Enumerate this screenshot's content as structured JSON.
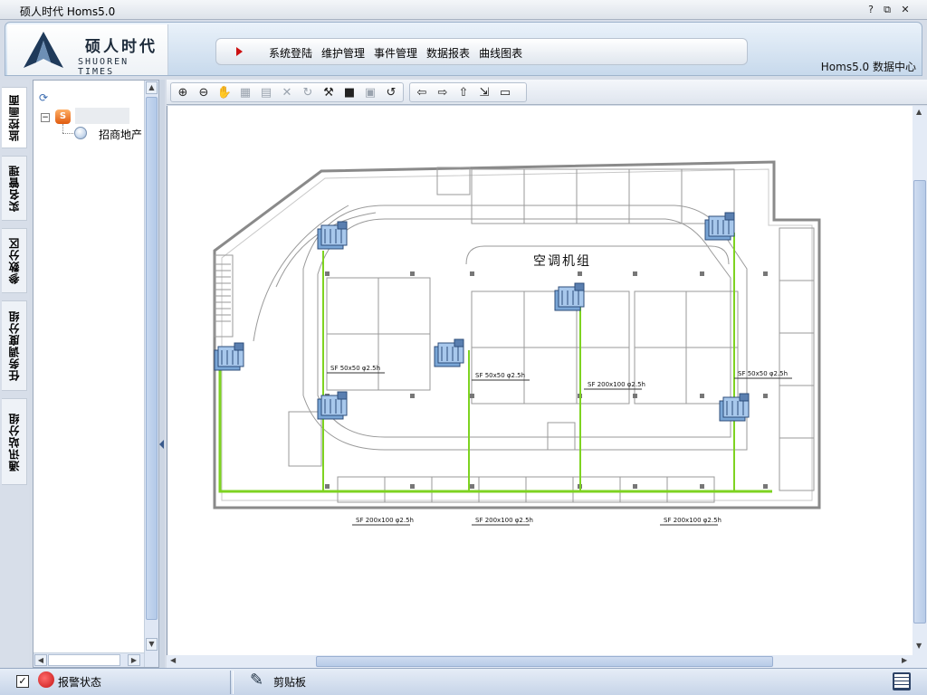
{
  "window": {
    "title": "硕人时代  Homs5.0",
    "help_label": "?",
    "restore_label": "⧉",
    "close_label": "✕"
  },
  "header": {
    "logo_cn": "硕人时代",
    "logo_en": "SHUOREN TIMES",
    "nav": [
      "系统登陆",
      "维护管理",
      "事件管理",
      "数据报表",
      "曲线图表"
    ],
    "right_label": "Homs5.0 数据中心"
  },
  "vtabs": [
    "监控画面",
    "实名管理",
    "参数分区",
    "任务调度分组",
    "通讯站分组"
  ],
  "tree": {
    "refresh_icon": "refresh-icon",
    "expander": "−",
    "root_icon_glyph": "S",
    "child_label": "招商地产"
  },
  "toolbar": {
    "group1": [
      {
        "icon": "zoom-in-icon",
        "glyph": "⊕",
        "enabled": true
      },
      {
        "icon": "zoom-out-icon",
        "glyph": "⊖",
        "enabled": true
      },
      {
        "icon": "pan-hand-icon",
        "glyph": "✋",
        "enabled": true
      },
      {
        "icon": "edit-icon",
        "glyph": "▦",
        "enabled": false
      },
      {
        "icon": "grid-icon",
        "glyph": "▤",
        "enabled": false
      },
      {
        "icon": "delete-icon",
        "glyph": "✕",
        "enabled": false
      },
      {
        "icon": "rotate-icon",
        "glyph": "↻",
        "enabled": false
      },
      {
        "icon": "tools-icon",
        "glyph": "⚒",
        "enabled": true
      },
      {
        "icon": "stop-icon",
        "glyph": "■",
        "enabled": true
      },
      {
        "icon": "image-icon",
        "glyph": "▣",
        "enabled": false
      },
      {
        "icon": "refresh-green-icon",
        "glyph": "↺",
        "enabled": true
      }
    ],
    "group2": [
      {
        "icon": "back-arrow-icon",
        "glyph": "⇦",
        "enabled": true
      },
      {
        "icon": "forward-arrow-icon",
        "glyph": "⇨",
        "enabled": true
      },
      {
        "icon": "folder-up-icon",
        "glyph": "⇧",
        "enabled": true
      },
      {
        "icon": "page-export-icon",
        "glyph": "⇲",
        "enabled": true
      },
      {
        "icon": "monitor-icon",
        "glyph": "▭",
        "enabled": true
      }
    ]
  },
  "drawing": {
    "caption": "空调机组",
    "equipment_icon": "air-conditioning-unit-icon",
    "pipe_color": "#7ed321",
    "line_color": "#9a9a9a",
    "pipe_labels": [
      "SF 50x50 φ2.5h",
      "SF 50x50 φ2.5h",
      "SF 200x100 φ2.5h",
      "SF 50x50 φ2.5h",
      "SF 200x100 φ2.5h",
      "SF 200x100 φ2.5h",
      "SF 200x100 φ2.5h"
    ]
  },
  "status": {
    "checkbox_checked": true,
    "alarm_label": "报警状态",
    "alarm_icon": "telephone-icon",
    "clipboard_label": "剪贴板",
    "clipboard_icon": "edit-pen-icon",
    "grid_icon": "layout-grid-icon"
  }
}
